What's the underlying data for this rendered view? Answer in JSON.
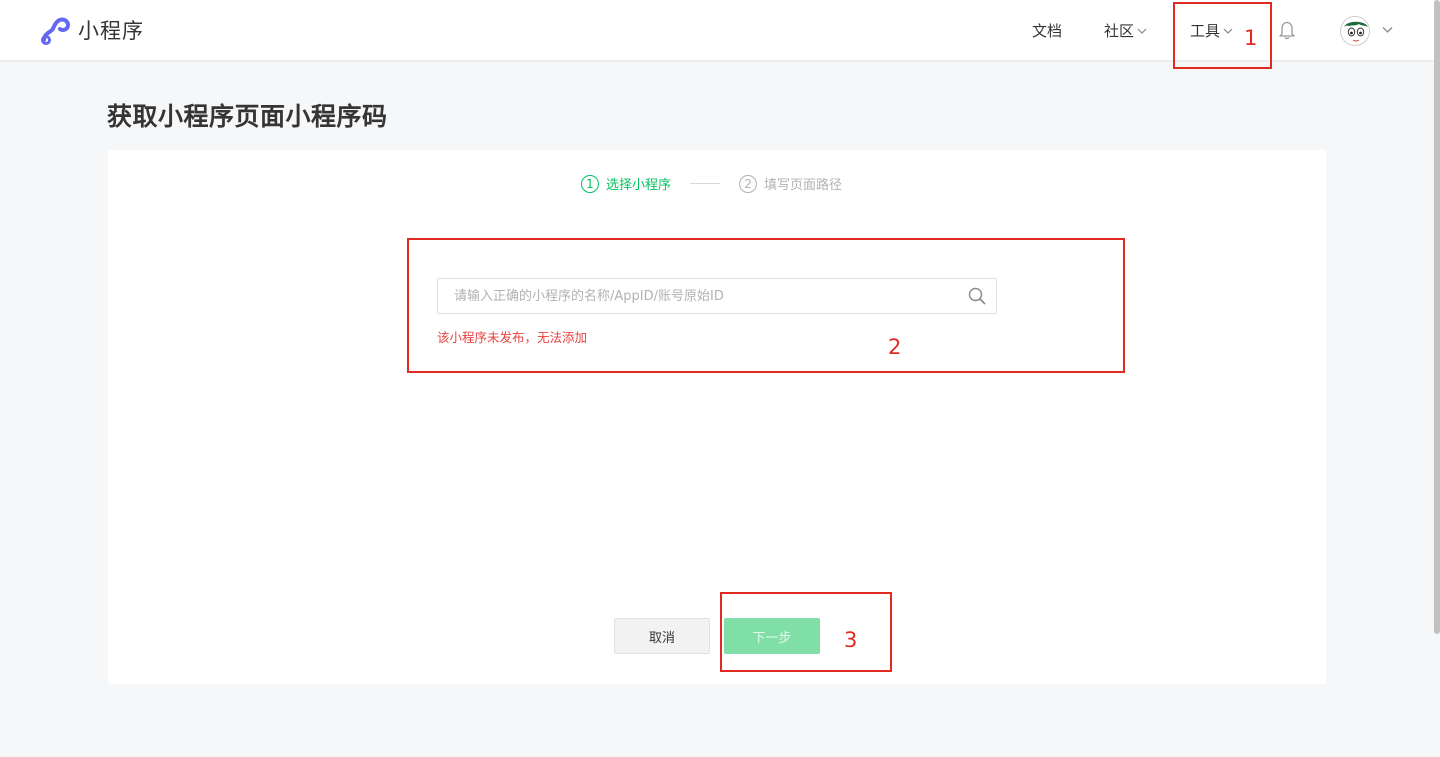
{
  "header": {
    "logo_text": "小程序",
    "nav": {
      "docs": "文档",
      "community": "社区",
      "tools": "工具"
    }
  },
  "page": {
    "title": "获取小程序页面小程序码"
  },
  "steps": [
    {
      "number": "1",
      "label": "选择小程序",
      "active": true
    },
    {
      "number": "2",
      "label": "填写页面路径",
      "active": false
    }
  ],
  "search": {
    "placeholder": "请输入正确的小程序的名称/AppID/账号原始ID",
    "value": ""
  },
  "error_message": "该小程序未发布，无法添加",
  "buttons": {
    "cancel": "取消",
    "next": "下一步"
  },
  "annotations": [
    "1",
    "2",
    "3"
  ],
  "colors": {
    "accent": "#07c160",
    "brand_logo": "#6467f0",
    "error": "#e64340",
    "annotation": "#e02b22",
    "next_disabled": "#80dfa6"
  }
}
